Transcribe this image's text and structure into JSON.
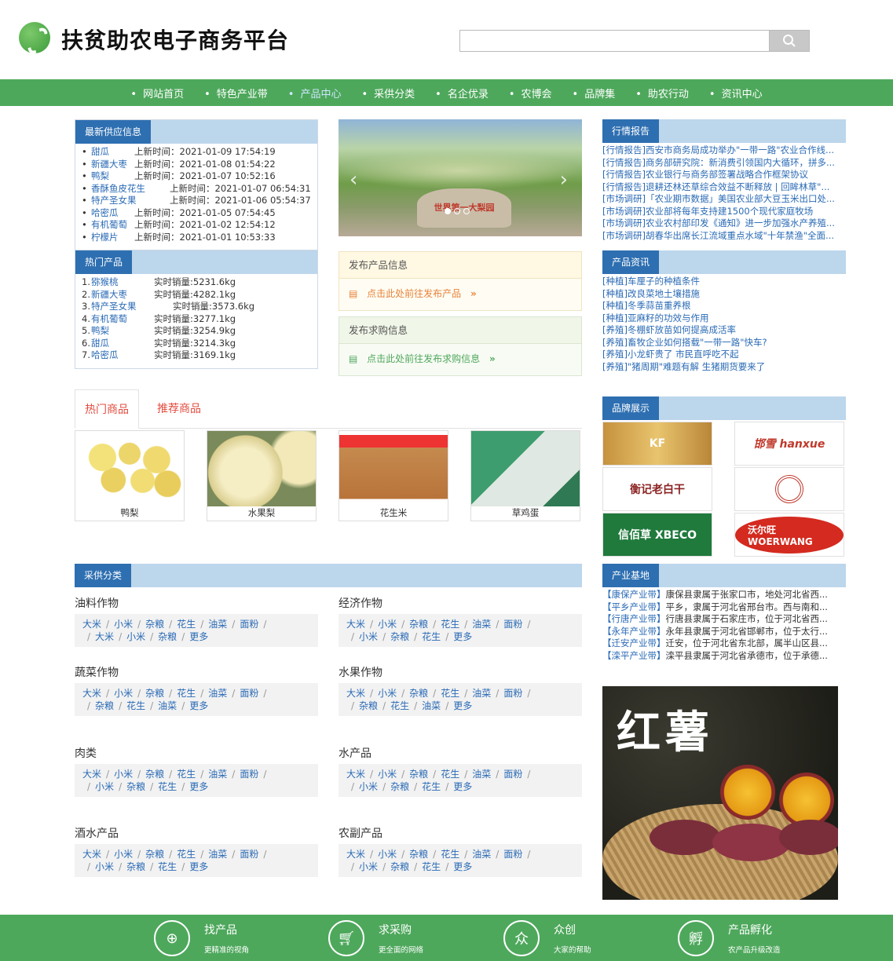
{
  "header": {
    "title": "扶贫助农电子商务平台",
    "search_placeholder": ""
  },
  "nav": [
    "网站首页",
    "特色产业带",
    "产品中心",
    "采供分类",
    "名企优录",
    "农博会",
    "品牌集",
    "助农行动",
    "资讯中心"
  ],
  "latest_supply": {
    "title": "最新供应信息",
    "items": [
      {
        "name": "甜瓜",
        "time": "上新时间：2021-01-09 17:54:19"
      },
      {
        "name": "新疆大枣",
        "time": "上新时间：2021-01-08 01:54:22"
      },
      {
        "name": "鸭梨",
        "time": "上新时间：2021-01-07 10:52:16"
      },
      {
        "name": "香酥鱼皮花生",
        "time": "上新时间：2021-01-07 06:54:31"
      },
      {
        "name": "特产圣女果",
        "time": "上新时间：2021-01-06 05:54:37"
      },
      {
        "name": "哈密瓜",
        "time": "上新时间：2021-01-05 07:54:45"
      },
      {
        "name": "有机葡萄",
        "time": "上新时间：2021-01-02 12:54:12"
      },
      {
        "name": "柠檬片",
        "time": "上新时间：2021-01-01 10:53:33"
      }
    ]
  },
  "hot_products": {
    "title": "热门产品",
    "items": [
      {
        "rank": "1.",
        "name": "猕猴桃",
        "sales": "实时销量:5231.6kg"
      },
      {
        "rank": "2.",
        "name": "新疆大枣",
        "sales": "实时销量:4282.1kg"
      },
      {
        "rank": "3.",
        "name": "特产圣女果",
        "sales": "实时销量:3573.6kg"
      },
      {
        "rank": "4.",
        "name": "有机葡萄",
        "sales": "实时销量:3277.1kg"
      },
      {
        "rank": "5.",
        "name": "鸭梨",
        "sales": "实时销量:3254.9kg"
      },
      {
        "rank": "6.",
        "name": "甜瓜",
        "sales": "实时销量:3214.3kg"
      },
      {
        "rank": "7.",
        "name": "哈密瓜",
        "sales": "实时销量:3169.1kg"
      }
    ]
  },
  "carousel": {
    "caption": "世界第一大梨园"
  },
  "publish": {
    "product": {
      "title": "发布产品信息",
      "link": "点击此处前往发布产品"
    },
    "purchase": {
      "title": "发布求购信息",
      "link": "点击此处前往发布求购信息"
    }
  },
  "market_report": {
    "title": "行情报告",
    "items": [
      "[行情报告]西安市商务局成功举办\"一带一路\"农业合作线...",
      "[行情报告]商务部研究院：新消费引领国内大循环，拼多...",
      "[行情报告]农业银行与商务部签署战略合作框架协议",
      "[行情报告]退耕还林还草综合效益不断释放 | 回眸林草\"...",
      "[市场调研]「农业期市数据」美国农业部大豆玉米出口处...",
      "[市场调研]农业部将每年支持建1500个现代家庭牧场",
      "[市场调研]农业农村部印发《通知》进一步加强水产养殖...",
      "[市场调研]胡春华出席长江流域重点水域\"十年禁渔\"全面..."
    ]
  },
  "product_news": {
    "title": "产品资讯",
    "items": [
      "[种植]车厘子的种植条件",
      "[种植]改良菜地土壤措施",
      "[种植]冬季蒜苗重养根",
      "[种植]亚麻籽的功效与作用",
      "[养殖]冬棚虾放苗如何提高成活率",
      "[养殖]畜牧企业如何搭载\"一带一路\"快车?",
      "[养殖]小龙虾贵了 市民直呼吃不起",
      "[养殖]\"猪周期\"难题有解 生猪期货要来了"
    ]
  },
  "tabs": [
    "热门商品",
    "推荐商品"
  ],
  "products": [
    "鸭梨",
    "水果梨",
    "花生米",
    "草鸡蛋"
  ],
  "brands": {
    "title": "品牌展示",
    "items": [
      "KF",
      "邯雪 hanxue",
      "衡记老白干",
      "商标",
      "信佰草 XBECO",
      "沃尔旺 WOERWANG"
    ]
  },
  "categories": {
    "title": "采供分类",
    "groups": [
      {
        "name": "油料作物",
        "row1": [
          "大米",
          "小米",
          "杂粮",
          "花生",
          "油菜",
          "面粉"
        ],
        "row2": [
          "大米",
          "小米",
          "杂粮",
          "更多"
        ]
      },
      {
        "name": "经济作物",
        "row1": [
          "大米",
          "小米",
          "杂粮",
          "花生",
          "油菜",
          "面粉"
        ],
        "row2": [
          "小米",
          "杂粮",
          "花生",
          "更多"
        ]
      },
      {
        "name": "蔬菜作物",
        "row1": [
          "大米",
          "小米",
          "杂粮",
          "花生",
          "油菜",
          "面粉"
        ],
        "row2": [
          "杂粮",
          "花生",
          "油菜",
          "更多"
        ]
      },
      {
        "name": "水果作物",
        "row1": [
          "大米",
          "小米",
          "杂粮",
          "花生",
          "油菜",
          "面粉"
        ],
        "row2": [
          "杂粮",
          "花生",
          "油菜",
          "更多"
        ]
      },
      {
        "name": "肉类",
        "row1": [
          "大米",
          "小米",
          "杂粮",
          "花生",
          "油菜",
          "面粉"
        ],
        "row2": [
          "小米",
          "杂粮",
          "花生",
          "更多"
        ]
      },
      {
        "name": "水产品",
        "row1": [
          "大米",
          "小米",
          "杂粮",
          "花生",
          "油菜",
          "面粉"
        ],
        "row2": [
          "小米",
          "杂粮",
          "花生",
          "更多"
        ]
      },
      {
        "name": "酒水产品",
        "row1": [
          "大米",
          "小米",
          "杂粮",
          "花生",
          "油菜",
          "面粉"
        ],
        "row2": [
          "小米",
          "杂粮",
          "花生",
          "更多"
        ]
      },
      {
        "name": "农副产品",
        "row1": [
          "大米",
          "小米",
          "杂粮",
          "花生",
          "油菜",
          "面粉"
        ],
        "row2": [
          "小米",
          "杂粮",
          "花生",
          "更多"
        ]
      }
    ]
  },
  "industry_base": {
    "title": "产业基地",
    "items": [
      {
        "tag": "【康保产业带】",
        "text": "康保县隶属于张家口市，地处河北省西..."
      },
      {
        "tag": "【平乡产业带】",
        "text": "平乡，隶属于河北省邢台市。西与南和..."
      },
      {
        "tag": "【行唐产业带】",
        "text": "行唐县隶属于石家庄市，位于河北省西..."
      },
      {
        "tag": "【永年产业带】",
        "text": "永年县隶属于河北省邯郸市，位于太行..."
      },
      {
        "tag": "【迁安产业带】",
        "text": "迁安，位于河北省东北部，属半山区县..."
      },
      {
        "tag": "【滦平产业带】",
        "text": "滦平县隶属于河北省承德市，位于承德..."
      }
    ]
  },
  "promo": {
    "text": "红薯"
  },
  "footer": [
    {
      "icon": "target-icon",
      "title": "找产品",
      "sub": "更精准的视角"
    },
    {
      "icon": "cart-icon",
      "title": "求采购",
      "sub": "更全面的网络"
    },
    {
      "icon": "crowd-icon",
      "title": "众创",
      "sub": "大家的帮助"
    },
    {
      "icon": "incubate-icon",
      "title": "产品孵化",
      "sub": "农产品升级改造"
    }
  ],
  "colors": {
    "green": "#4ea85c",
    "blue_tag": "#2e6fb1",
    "link": "#2a6ab5",
    "red_tab": "#e24c3f"
  }
}
